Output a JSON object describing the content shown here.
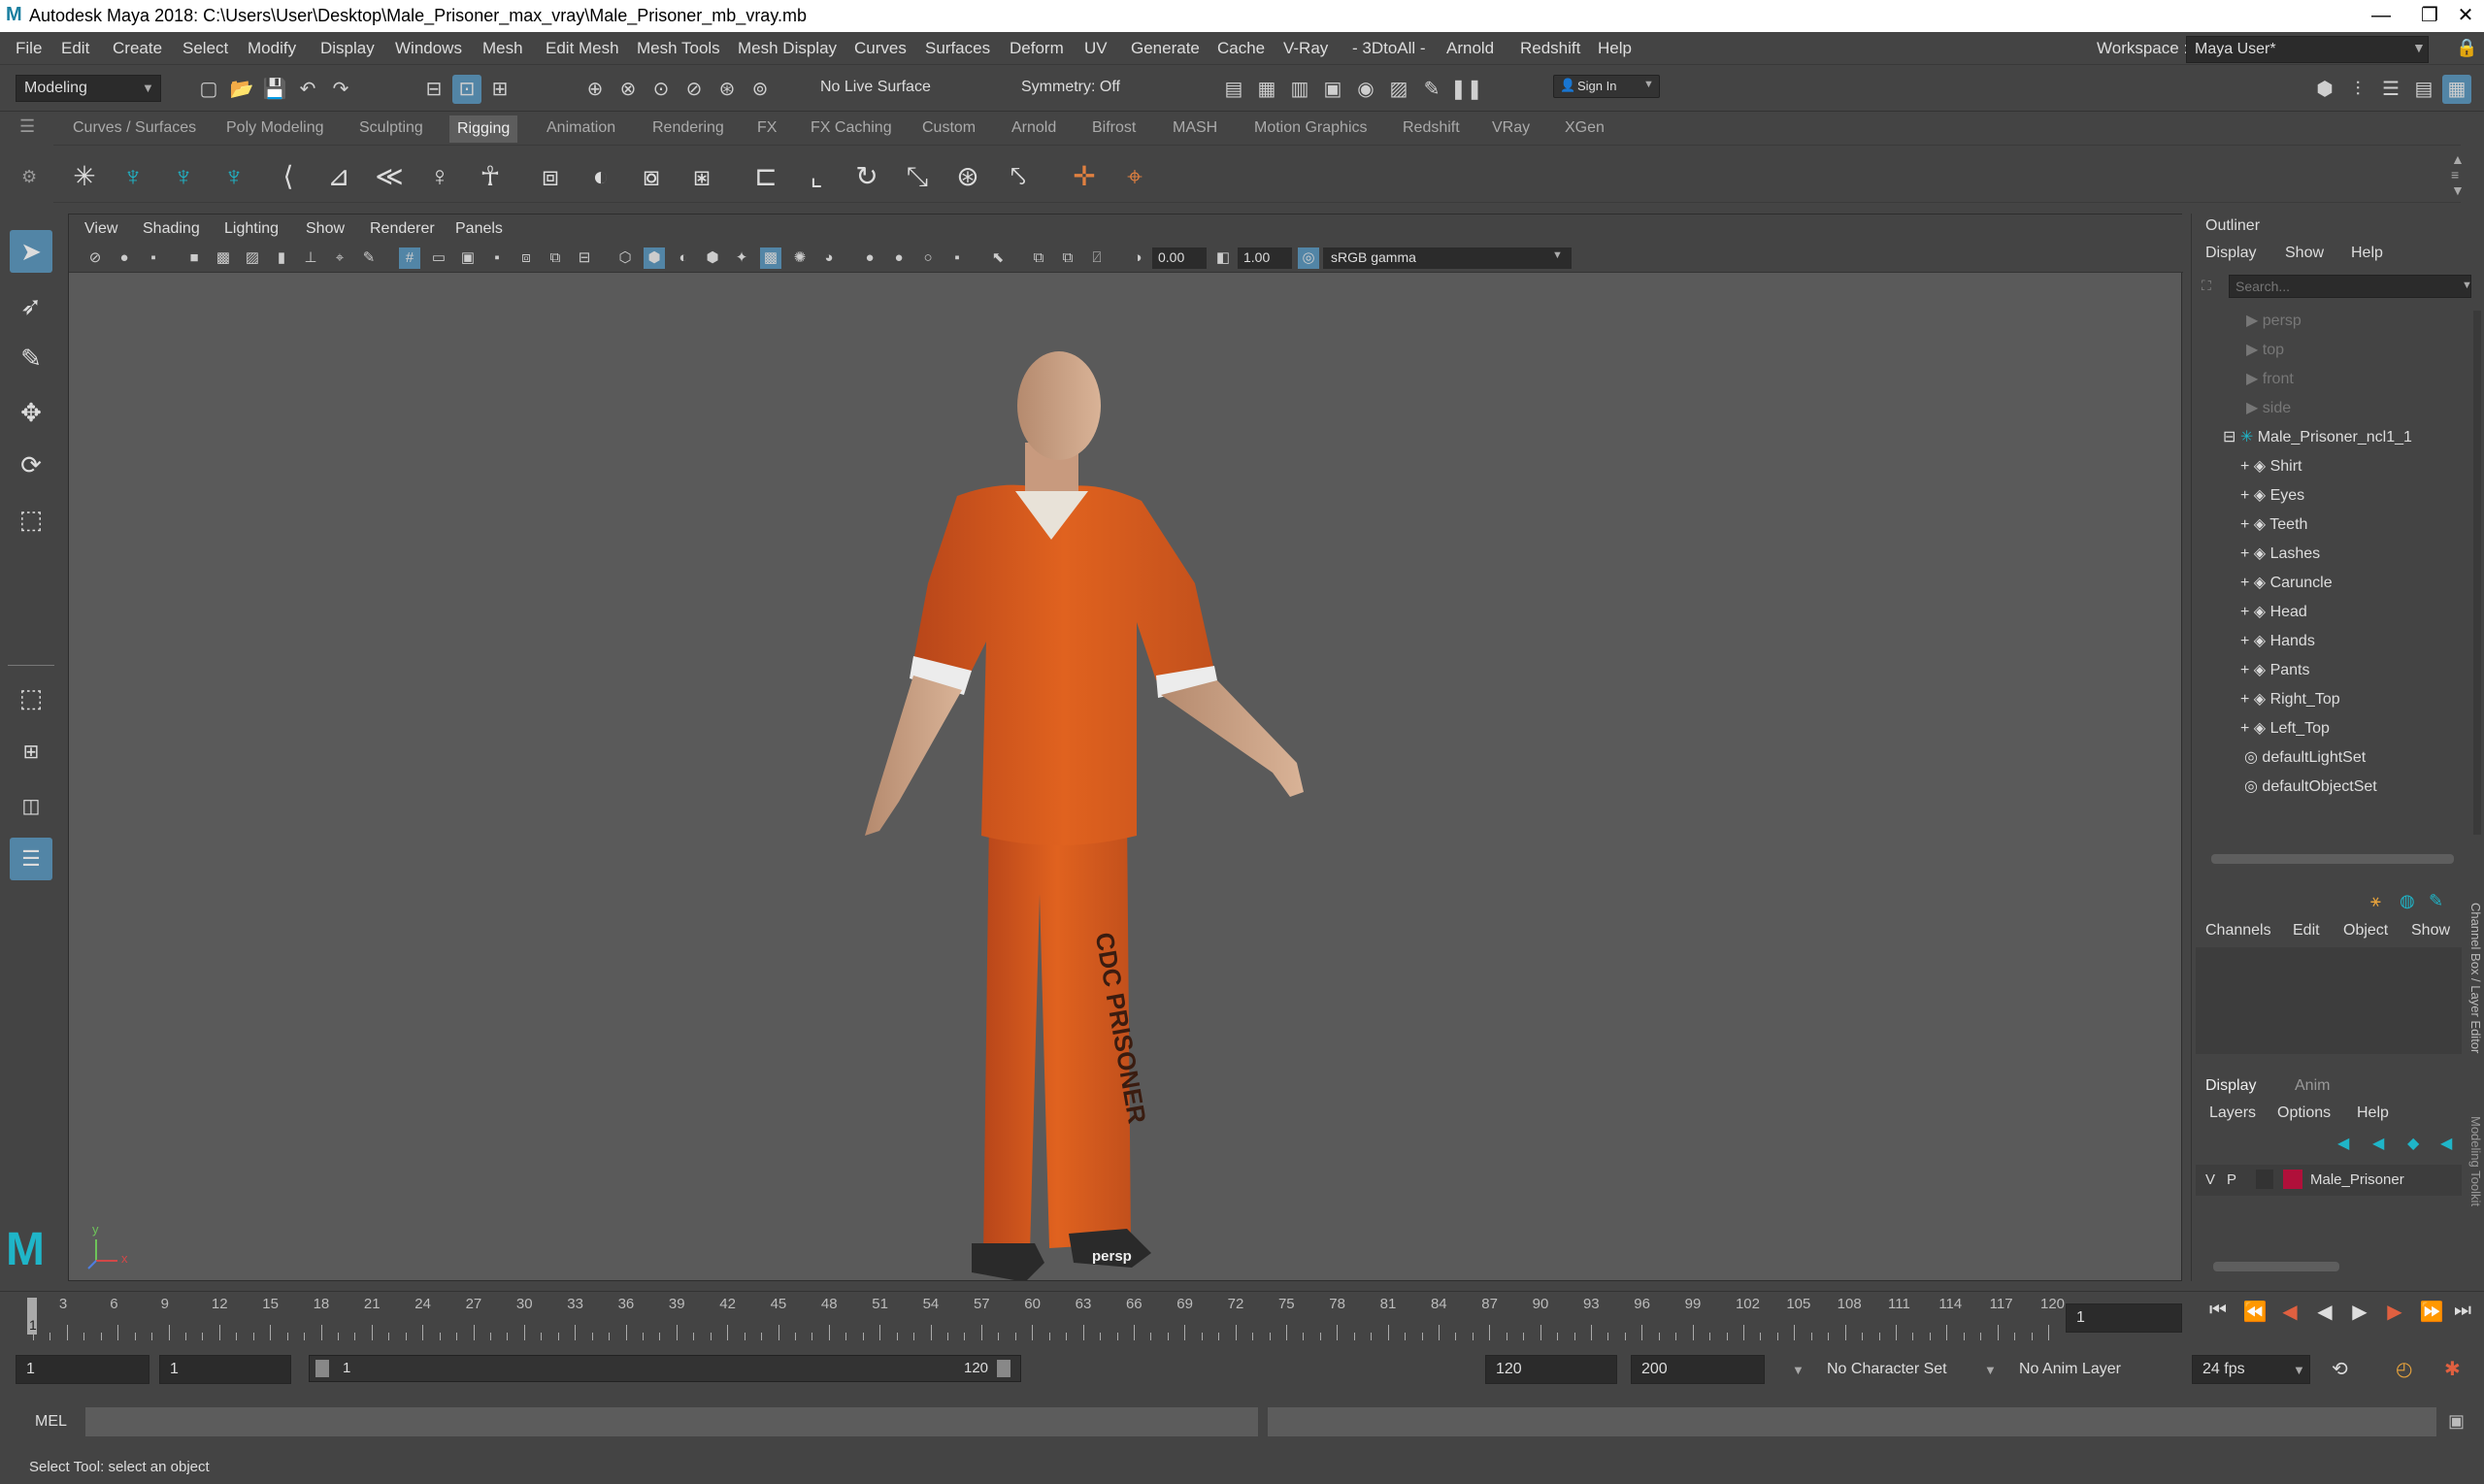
{
  "window": {
    "title": "Autodesk Maya 2018: C:\\Users\\User\\Desktop\\Male_Prisoner_max_vray\\Male_Prisoner_mb_vray.mb",
    "minimize": "—",
    "maximize": "❐",
    "close": "✕"
  },
  "menubar": [
    "File",
    "Edit",
    "Create",
    "Select",
    "Modify",
    "Display",
    "Windows",
    "Mesh",
    "Edit Mesh",
    "Mesh Tools",
    "Mesh Display",
    "Curves",
    "Surfaces",
    "Deform",
    "UV",
    "Generate",
    "Cache",
    "V-Ray",
    "- 3DtoAll -",
    "Arnold",
    "Redshift",
    "Help"
  ],
  "workspace": {
    "label": "Workspace :",
    "value": "Maya User*"
  },
  "statusline": {
    "mode": "Modeling",
    "live_surface": "No Live Surface",
    "symmetry": "Symmetry: Off",
    "sign_in": "Sign In"
  },
  "shelf_tabs": [
    "Curves / Surfaces",
    "Poly Modeling",
    "Sculpting",
    "Rigging",
    "Animation",
    "Rendering",
    "FX",
    "FX Caching",
    "Custom",
    "Arnold",
    "Bifrost",
    "MASH",
    "Motion Graphics",
    "Redshift",
    "VRay",
    "XGen"
  ],
  "active_shelf": "Rigging",
  "viewport": {
    "menus": [
      "View",
      "Shading",
      "Lighting",
      "Show",
      "Renderer",
      "Panels"
    ],
    "exposure": "0.00",
    "gamma": "1.00",
    "color_space": "sRGB gamma",
    "camera_label": "persp",
    "axis_x": "x",
    "axis_y": "y",
    "pants_text": "CDC PRISONER"
  },
  "outliner": {
    "title": "Outliner",
    "menus": [
      "Display",
      "Show",
      "Help"
    ],
    "search_placeholder": "Search...",
    "cameras": [
      "persp",
      "top",
      "front",
      "side"
    ],
    "group": "Male_Prisoner_ncl1_1",
    "children": [
      "Shirt",
      "Eyes",
      "Teeth",
      "Lashes",
      "Caruncle",
      "Head",
      "Hands",
      "Pants",
      "Right_Top",
      "Left_Top"
    ],
    "sets": [
      "defaultLightSet",
      "defaultObjectSet"
    ]
  },
  "channelbox": {
    "menus": [
      "Channels",
      "Edit",
      "Object",
      "Show"
    ],
    "side_tab": "Channel Box / Layer Editor",
    "side_tab2": "Modeling Toolkit",
    "layer_tabs": [
      "Display",
      "Anim"
    ],
    "layer_menus": [
      "Layers",
      "Options",
      "Help"
    ],
    "layer": {
      "v": "V",
      "p": "P",
      "name": "Male_Prisoner",
      "color": "#b0103a"
    }
  },
  "timeline": {
    "ticks": [
      "3",
      "6",
      "9",
      "12",
      "15",
      "18",
      "21",
      "24",
      "27",
      "30",
      "33",
      "36",
      "39",
      "42",
      "45",
      "48",
      "51",
      "54",
      "57",
      "60",
      "63",
      "66",
      "69",
      "72",
      "75",
      "78",
      "81",
      "84",
      "87",
      "90",
      "93",
      "96",
      "99",
      "102",
      "105",
      "108",
      "111",
      "114",
      "117",
      "120"
    ],
    "current_marker": "1",
    "current_frame": "1"
  },
  "range": {
    "start": "1",
    "playback_start": "1",
    "slider_start": "1",
    "slider_end": "120",
    "playback_end": "120",
    "end": "200",
    "character_set": "No Character Set",
    "anim_layer": "No Anim Layer",
    "fps": "24 fps"
  },
  "cmdline": {
    "label": "MEL"
  },
  "helpline": {
    "text": "Select Tool: select an object"
  },
  "colors": {
    "accent": "#5285a6",
    "shirt": "#d8561f",
    "maya_logo": "#1fb5c8"
  }
}
